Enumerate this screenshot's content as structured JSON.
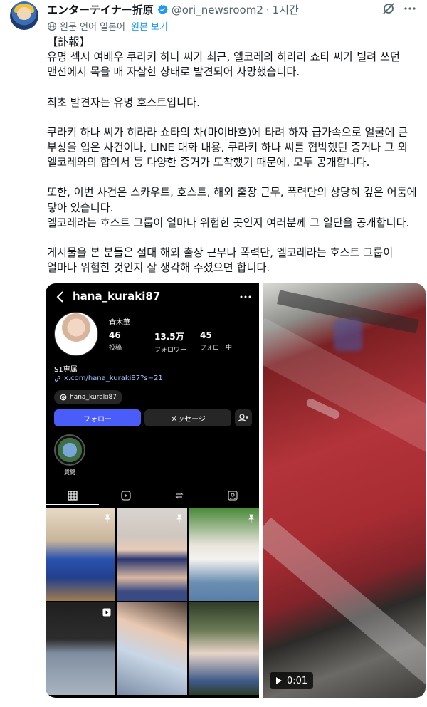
{
  "post": {
    "author": {
      "display_name": "エンターテイナー折原",
      "handle": "@ori_newsroom2",
      "time": "1시간",
      "dot": "·"
    },
    "translation": {
      "label": "원문 언어 일본어",
      "show_original": "원본 보기"
    },
    "text": {
      "p1": "【訃報】",
      "p2": "유명 섹시 여배우 쿠라키 하나 씨가 최근, 엘코레의 히라라 쇼타 씨가 빌려 쓰던 맨션에서 목을 매 자살한 상태로 발견되어 사망했습니다.",
      "p3": "최초 발견자는 유명 호스트입니다.",
      "p4": "쿠라키 하나 씨가 히라라 쇼타의 차(마이바흐)에 타려 하자 급가속으로 얼굴에 큰 부상을 입은 사건이나, LINE 대화 내용, 쿠라키 하나 씨를 협박했던 증거나 그 외 엘코레와의 합의서 등 다양한 증거가 도착했기 때문에, 모두 공개합니다.",
      "p5": "또한, 이번 사건은 스카우트, 호스트, 해외 출장 근무, 폭력단의 상당히 깊은 어둠에 닿아 있습니다.",
      "p6": "엘코레라는 호스트 그룹이 얼마나 위험한 곳인지 여러분께 그 일단을 공개합니다.",
      "p7": "게시물을 본 분들은 절대 해외 출장 근무나 폭력단, 엘코레라는 호스트 그룹이 얼마나 위험한 것인지 잘 생각해 주셨으면 합니다."
    }
  },
  "instagram": {
    "username": "hana_kuraki87",
    "display_name": "倉木華",
    "stats": [
      {
        "num": "46",
        "label": "投稿"
      },
      {
        "num": "13.5万",
        "label": "フォロワー"
      },
      {
        "num": "45",
        "label": "フォロー中"
      }
    ],
    "bio": "S1専属",
    "link": "x.com/hana_kuraki87?s=21",
    "threads": "hana_kuraki87",
    "follow_label": "フォロー",
    "message_label": "メッセージ",
    "highlight_label": "質問"
  },
  "video": {
    "duration": "0:01"
  },
  "colors": {
    "link_blue": "#1d9bf0",
    "ig_follow": "#4a5df9",
    "text_primary": "#0f1419",
    "text_secondary": "#536471"
  },
  "icons": {
    "verified": "verified-badge-icon",
    "grok": "grok-icon",
    "more": "more-icon",
    "globe": "globe-icon",
    "play": "play-icon"
  }
}
